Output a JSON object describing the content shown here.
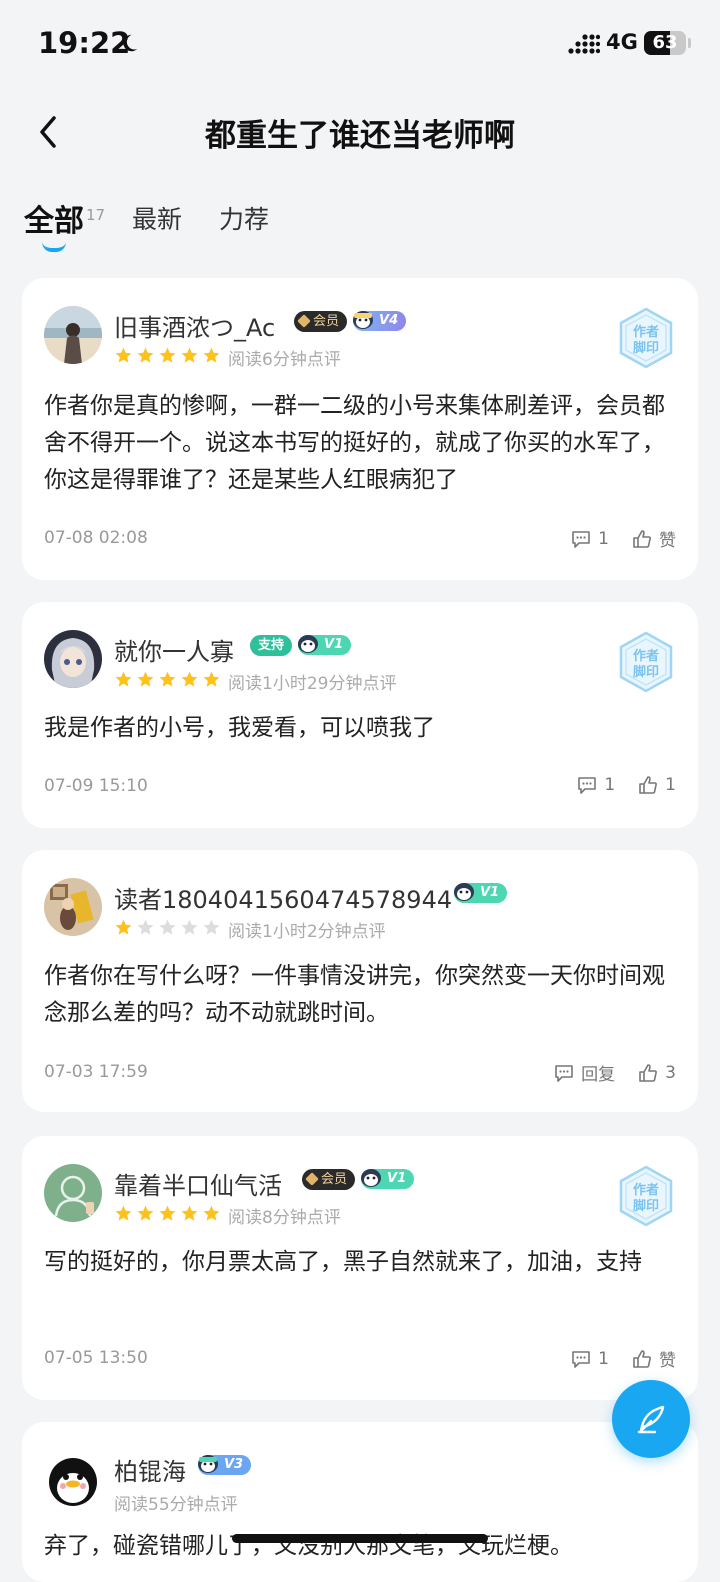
{
  "status_bar": {
    "time": "19:22",
    "network": "4G",
    "battery": "63",
    "battery_level": 0.63
  },
  "header": {
    "title": "都重生了谁还当老师啊"
  },
  "tabs": [
    {
      "label": "全部",
      "count": "17",
      "active": true
    },
    {
      "label": "最新"
    },
    {
      "label": "力荐"
    }
  ],
  "colors": {
    "accent": "#1aa7f2",
    "star": "#ffc21a",
    "star_empty": "#dddddd"
  },
  "comments": [
    {
      "username": "旧事酒浓つ_Ac",
      "member_badge": "会员",
      "level": "V4",
      "rating": 5,
      "read_time": "阅读6分钟点评",
      "author_stamp": "作者\n脚印",
      "text": "作者你是真的惨啊，一群一二级的小号来集体刷差评，会员都舍不得开一个。说这本书写的挺好的，就成了你买的水军了，你这是得罪谁了？还是某些人红眼病犯了",
      "date": "07-08 02:08",
      "reply_count": "1",
      "like_label": "赞"
    },
    {
      "username": "就你一人寡",
      "support_badge": "支持",
      "level": "V1",
      "rating": 5,
      "read_time": "阅读1小时29分钟点评",
      "author_stamp": "作者\n脚印",
      "text": "我是作者的小号，我爱看，可以喷我了",
      "date": "07-09 15:10",
      "reply_count": "1",
      "like_label": "1"
    },
    {
      "username": "读者1804041560474578944",
      "level": "V1",
      "rating": 1,
      "read_time": "阅读1小时2分钟点评",
      "text": "作者你在写什么呀？一件事情没讲完，你突然变一天你时间观念那么差的吗？动不动就跳时间。",
      "date": "07-03 17:59",
      "reply_label": "回复",
      "like_label": "3"
    },
    {
      "username": "靠着半口仙气活",
      "member_badge": "会员",
      "level": "V1",
      "rating": 5,
      "read_time": "阅读8分钟点评",
      "author_stamp": "作者\n脚印",
      "text": "写的挺好的，你月票太高了，黑子自然就来了，加油，支持",
      "date": "07-05 13:50",
      "reply_count": "1",
      "like_label": "赞"
    },
    {
      "username": "柏锟海",
      "level": "V3",
      "read_time": "阅读55分钟点评",
      "text": "弃了，碰瓷错哪儿了，又没别人那文笔，又玩烂梗。"
    }
  ],
  "icons": {
    "back": "chevron-left-icon",
    "moon": "moon-icon",
    "signal": "signal-icon",
    "comment": "comment-icon",
    "like": "thumb-up-icon",
    "fab": "quill-icon"
  }
}
